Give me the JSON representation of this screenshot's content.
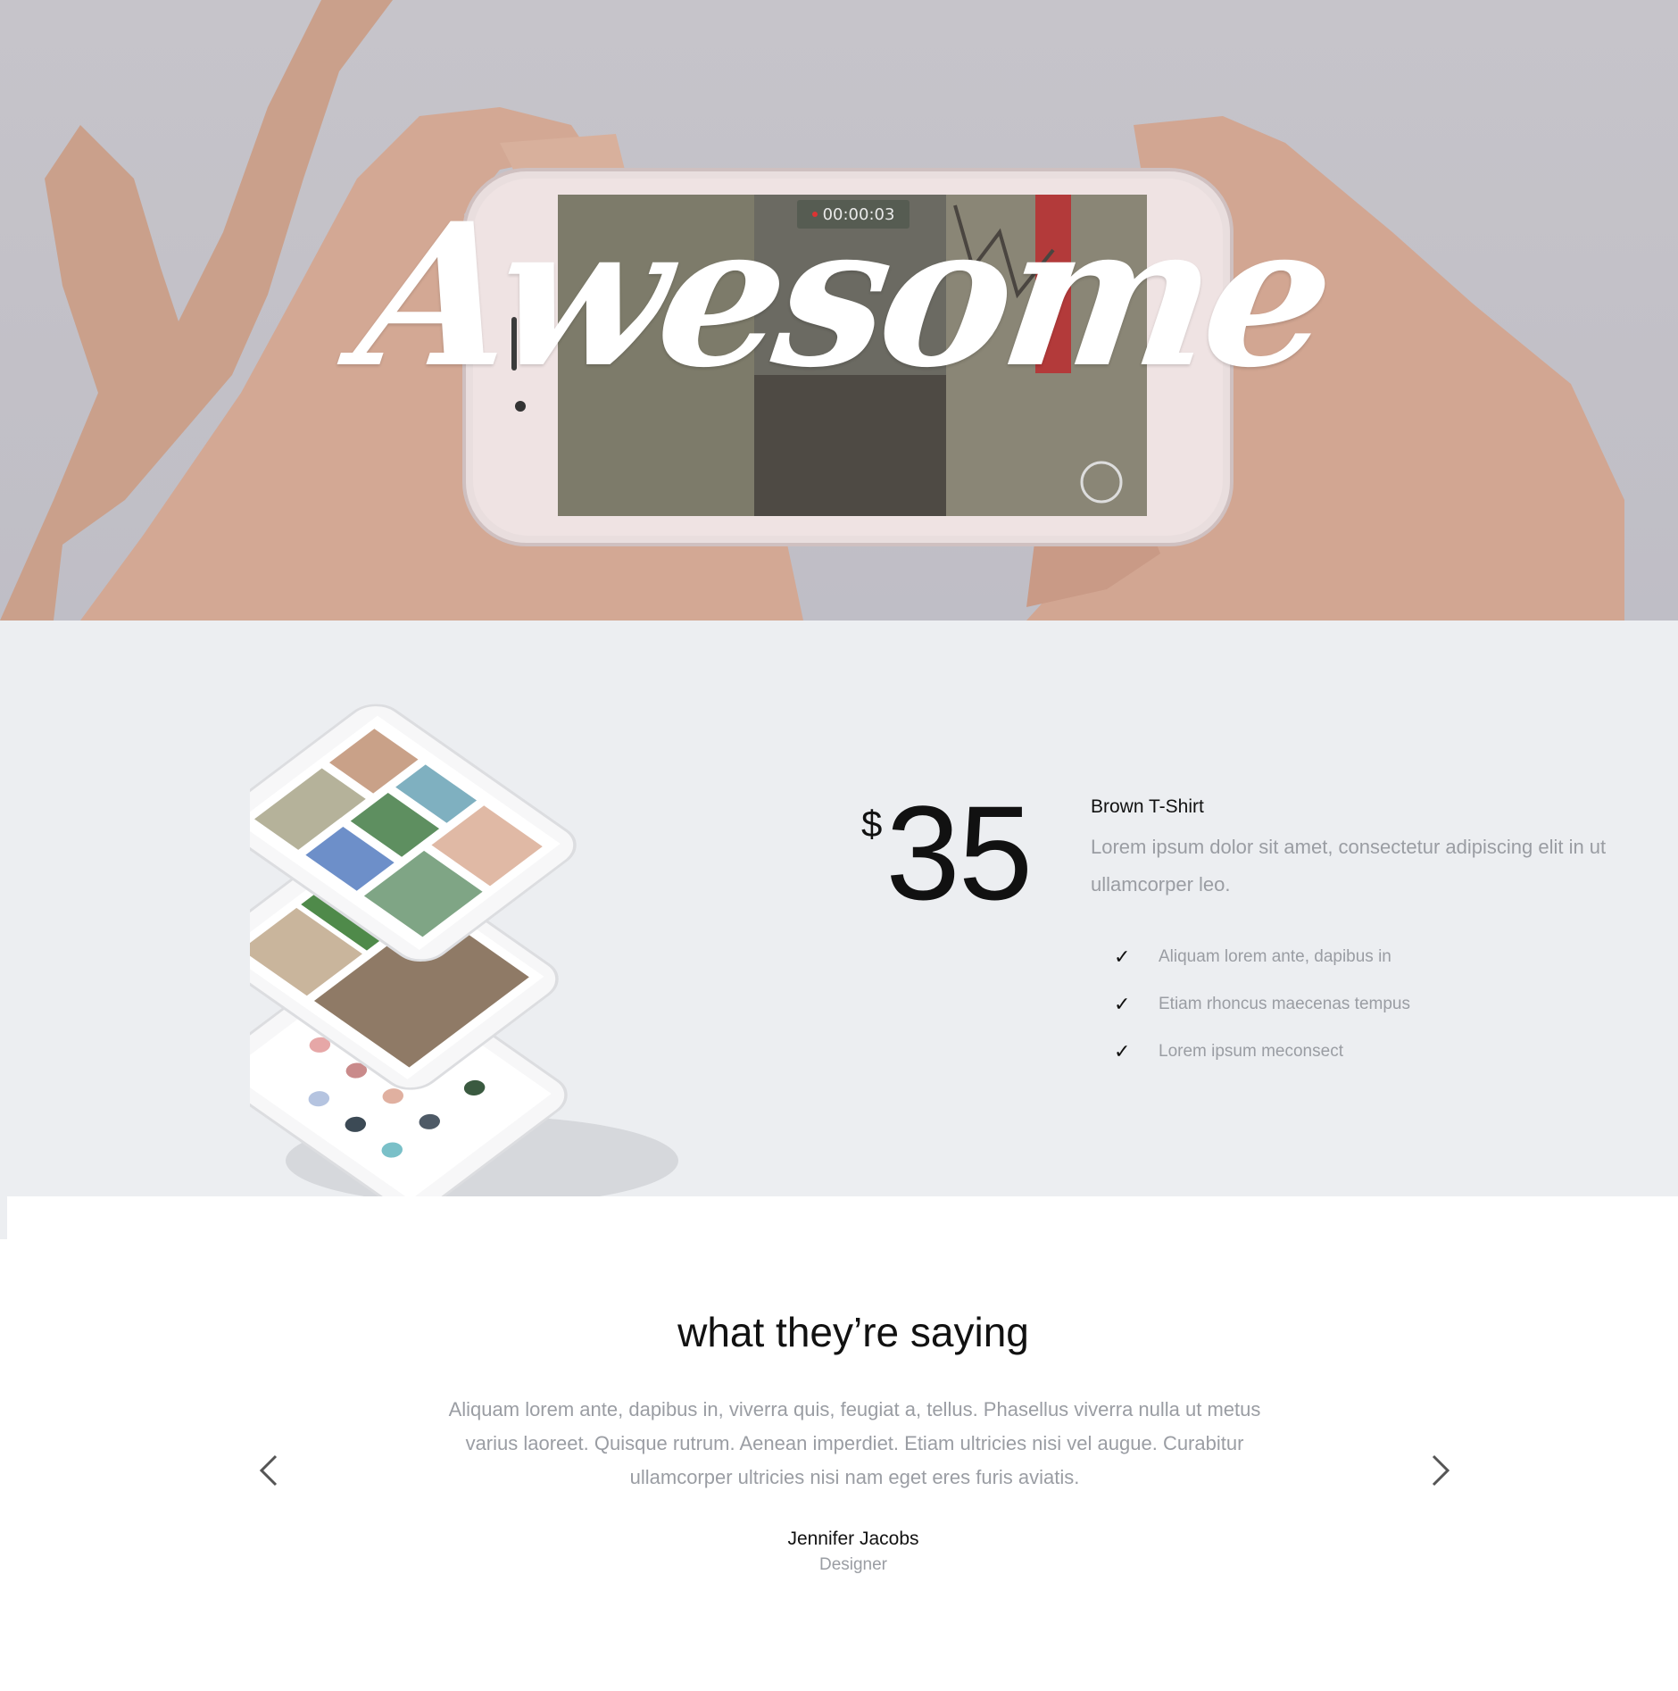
{
  "hero": {
    "script_title": "Awesome",
    "recording_time": "00:00:03"
  },
  "product": {
    "currency": "$",
    "price": "35",
    "name": "Brown T-Shirt",
    "description": "Lorem ipsum dolor sit amet, consectetur adipiscing elit in ut ullamcorper leo.",
    "features": [
      "Aliquam lorem ante, dapibus in",
      "Etiam rhoncus maecenas tempus",
      "Lorem ipsum meconsect"
    ]
  },
  "testimonial": {
    "heading": "what they’re saying",
    "quote": "Aliquam lorem ante, dapibus in, viverra quis, feugiat a, tellus. Phasellus viverra nulla ut metus varius laoreet. Quisque rutrum. Aenean imperdiet. Etiam ultricies nisi vel augue. Curabitur ullamcorper ultricies nisi nam eget eres furis aviatis.",
    "author": "Jennifer Jacobs",
    "role": "Designer"
  },
  "icons": {
    "prev": "chevron-left-icon",
    "next": "chevron-right-icon",
    "feature": "check-icon"
  },
  "colors": {
    "hero_bg": "#c4c2c9",
    "product_bg": "#eceef1",
    "text_dark": "#111111",
    "text_muted": "#9a9da3"
  }
}
